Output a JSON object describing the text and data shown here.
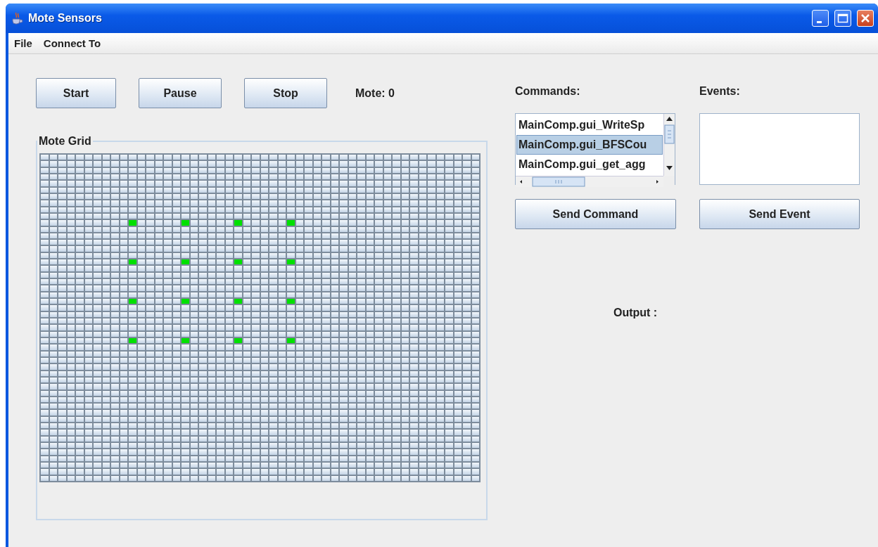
{
  "window": {
    "title": "Mote Sensors"
  },
  "menu": [
    "File",
    "Connect To"
  ],
  "controls": {
    "buttons": [
      "Start",
      "Pause",
      "Stop"
    ],
    "mote_label": "Mote: 0"
  },
  "grid": {
    "title": "Mote Grid",
    "rows": [
      [
        false,
        false,
        false,
        false,
        false,
        false,
        false,
        false,
        false,
        false,
        false,
        false,
        false,
        false,
        false,
        false,
        false,
        false,
        false,
        false,
        false,
        false,
        false,
        false,
        false,
        false,
        false,
        false,
        false,
        false,
        false,
        false,
        false,
        false,
        false,
        false,
        false,
        false,
        false,
        false,
        false,
        false,
        false,
        false,
        false,
        false,
        false,
        false,
        false,
        false
      ],
      [
        false,
        false,
        false,
        false,
        false,
        false,
        false,
        false,
        false,
        false,
        false,
        false,
        false,
        false,
        false,
        false,
        false,
        false,
        false,
        false,
        false,
        false,
        false,
        false,
        false,
        false,
        false,
        false,
        false,
        false,
        false,
        false,
        false,
        false,
        false,
        false,
        false,
        false,
        false,
        false,
        false,
        false,
        false,
        false,
        false,
        false,
        false,
        false,
        false,
        false
      ],
      [
        false,
        false,
        false,
        false,
        false,
        false,
        false,
        false,
        false,
        false,
        false,
        false,
        false,
        false,
        false,
        false,
        false,
        false,
        false,
        false,
        false,
        false,
        false,
        false,
        false,
        false,
        false,
        false,
        false,
        false,
        false,
        false,
        false,
        false,
        false,
        false,
        false,
        false,
        false,
        false,
        false,
        false,
        false,
        false,
        false,
        false,
        false,
        false,
        false,
        false
      ],
      [
        false,
        false,
        false,
        false,
        false,
        false,
        false,
        false,
        false,
        false,
        false,
        false,
        false,
        false,
        false,
        false,
        false,
        false,
        false,
        false,
        false,
        false,
        false,
        false,
        false,
        false,
        false,
        false,
        false,
        false,
        false,
        false,
        false,
        false,
        false,
        false,
        false,
        false,
        false,
        false,
        false,
        false,
        false,
        false,
        false,
        false,
        false,
        false,
        false,
        false
      ],
      [
        false,
        false,
        false,
        false,
        false,
        false,
        false,
        false,
        false,
        false,
        false,
        false,
        false,
        false,
        false,
        false,
        false,
        false,
        false,
        false,
        false,
        false,
        false,
        false,
        false,
        false,
        false,
        false,
        false,
        false,
        false,
        false,
        false,
        false,
        false,
        false,
        false,
        false,
        false,
        false,
        false,
        false,
        false,
        false,
        false,
        false,
        false,
        false,
        false,
        false
      ],
      [
        false,
        false,
        false,
        false,
        false,
        false,
        false,
        false,
        false,
        false,
        false,
        false,
        false,
        false,
        false,
        false,
        false,
        false,
        false,
        false,
        false,
        false,
        false,
        false,
        false,
        false,
        false,
        false,
        false,
        false,
        false,
        false,
        false,
        false,
        false,
        false,
        false,
        false,
        false,
        false,
        false,
        false,
        false,
        false,
        false,
        false,
        false,
        false,
        false,
        false
      ],
      [
        false,
        false,
        false,
        false,
        false,
        false,
        false,
        false,
        false,
        false,
        false,
        false,
        false,
        false,
        false,
        false,
        false,
        false,
        false,
        false,
        false,
        false,
        false,
        false,
        false,
        false,
        false,
        false,
        false,
        false,
        false,
        false,
        false,
        false,
        false,
        false,
        false,
        false,
        false,
        false,
        false,
        false,
        false,
        false,
        false,
        false,
        false,
        false,
        false,
        false
      ],
      [
        false,
        false,
        false,
        false,
        false,
        false,
        false,
        false,
        false,
        false,
        false,
        false,
        false,
        false,
        false,
        false,
        false,
        false,
        false,
        false,
        false,
        false,
        false,
        false,
        false,
        false,
        false,
        false,
        false,
        false,
        false,
        false,
        false,
        false,
        false,
        false,
        false,
        false,
        false,
        false,
        false,
        false,
        false,
        false,
        false,
        false,
        false,
        false,
        false,
        false
      ],
      [
        false,
        false,
        false,
        false,
        false,
        false,
        false,
        false,
        false,
        false,
        false,
        false,
        false,
        false,
        false,
        false,
        false,
        false,
        false,
        false,
        false,
        false,
        false,
        false,
        false,
        false,
        false,
        false,
        false,
        false,
        false,
        false,
        false,
        false,
        false,
        false,
        false,
        false,
        false,
        false,
        false,
        false,
        false,
        false,
        false,
        false,
        false,
        false,
        false,
        false
      ],
      [
        false,
        false,
        false,
        false,
        false,
        false,
        false,
        false,
        false,
        false,
        false,
        false,
        false,
        false,
        false,
        false,
        false,
        false,
        false,
        false,
        false,
        false,
        false,
        false,
        false,
        false,
        false,
        false,
        false,
        false,
        false,
        false,
        false,
        false,
        false,
        false,
        false,
        false,
        false,
        false,
        false,
        false,
        false,
        false,
        false,
        false,
        false,
        false,
        false,
        false
      ],
      [
        false,
        false,
        false,
        false,
        false,
        false,
        false,
        false,
        false,
        false,
        true,
        false,
        false,
        false,
        false,
        false,
        true,
        false,
        false,
        false,
        false,
        false,
        true,
        false,
        false,
        false,
        false,
        false,
        true,
        false,
        false,
        false,
        false,
        false,
        false,
        false,
        false,
        false,
        false,
        false,
        false,
        false,
        false,
        false,
        false,
        false,
        false,
        false,
        false,
        false
      ],
      [
        false,
        false,
        false,
        false,
        false,
        false,
        false,
        false,
        false,
        false,
        false,
        false,
        false,
        false,
        false,
        false,
        false,
        false,
        false,
        false,
        false,
        false,
        false,
        false,
        false,
        false,
        false,
        false,
        false,
        false,
        false,
        false,
        false,
        false,
        false,
        false,
        false,
        false,
        false,
        false,
        false,
        false,
        false,
        false,
        false,
        false,
        false,
        false,
        false,
        false
      ],
      [
        false,
        false,
        false,
        false,
        false,
        false,
        false,
        false,
        false,
        false,
        false,
        false,
        false,
        false,
        false,
        false,
        false,
        false,
        false,
        false,
        false,
        false,
        false,
        false,
        false,
        false,
        false,
        false,
        false,
        false,
        false,
        false,
        false,
        false,
        false,
        false,
        false,
        false,
        false,
        false,
        false,
        false,
        false,
        false,
        false,
        false,
        false,
        false,
        false,
        false
      ],
      [
        false,
        false,
        false,
        false,
        false,
        false,
        false,
        false,
        false,
        false,
        false,
        false,
        false,
        false,
        false,
        false,
        false,
        false,
        false,
        false,
        false,
        false,
        false,
        false,
        false,
        false,
        false,
        false,
        false,
        false,
        false,
        false,
        false,
        false,
        false,
        false,
        false,
        false,
        false,
        false,
        false,
        false,
        false,
        false,
        false,
        false,
        false,
        false,
        false,
        false
      ],
      [
        false,
        false,
        false,
        false,
        false,
        false,
        false,
        false,
        false,
        false,
        false,
        false,
        false,
        false,
        false,
        false,
        false,
        false,
        false,
        false,
        false,
        false,
        false,
        false,
        false,
        false,
        false,
        false,
        false,
        false,
        false,
        false,
        false,
        false,
        false,
        false,
        false,
        false,
        false,
        false,
        false,
        false,
        false,
        false,
        false,
        false,
        false,
        false,
        false,
        false
      ],
      [
        false,
        false,
        false,
        false,
        false,
        false,
        false,
        false,
        false,
        false,
        false,
        false,
        false,
        false,
        false,
        false,
        false,
        false,
        false,
        false,
        false,
        false,
        false,
        false,
        false,
        false,
        false,
        false,
        false,
        false,
        false,
        false,
        false,
        false,
        false,
        false,
        false,
        false,
        false,
        false,
        false,
        false,
        false,
        false,
        false,
        false,
        false,
        false,
        false,
        false
      ],
      [
        false,
        false,
        false,
        false,
        false,
        false,
        false,
        false,
        false,
        false,
        true,
        false,
        false,
        false,
        false,
        false,
        true,
        false,
        false,
        false,
        false,
        false,
        true,
        false,
        false,
        false,
        false,
        false,
        true,
        false,
        false,
        false,
        false,
        false,
        false,
        false,
        false,
        false,
        false,
        false,
        false,
        false,
        false,
        false,
        false,
        false,
        false,
        false,
        false,
        false
      ],
      [
        false,
        false,
        false,
        false,
        false,
        false,
        false,
        false,
        false,
        false,
        false,
        false,
        false,
        false,
        false,
        false,
        false,
        false,
        false,
        false,
        false,
        false,
        false,
        false,
        false,
        false,
        false,
        false,
        false,
        false,
        false,
        false,
        false,
        false,
        false,
        false,
        false,
        false,
        false,
        false,
        false,
        false,
        false,
        false,
        false,
        false,
        false,
        false,
        false,
        false
      ],
      [
        false,
        false,
        false,
        false,
        false,
        false,
        false,
        false,
        false,
        false,
        false,
        false,
        false,
        false,
        false,
        false,
        false,
        false,
        false,
        false,
        false,
        false,
        false,
        false,
        false,
        false,
        false,
        false,
        false,
        false,
        false,
        false,
        false,
        false,
        false,
        false,
        false,
        false,
        false,
        false,
        false,
        false,
        false,
        false,
        false,
        false,
        false,
        false,
        false,
        false
      ],
      [
        false,
        false,
        false,
        false,
        false,
        false,
        false,
        false,
        false,
        false,
        false,
        false,
        false,
        false,
        false,
        false,
        false,
        false,
        false,
        false,
        false,
        false,
        false,
        false,
        false,
        false,
        false,
        false,
        false,
        false,
        false,
        false,
        false,
        false,
        false,
        false,
        false,
        false,
        false,
        false,
        false,
        false,
        false,
        false,
        false,
        false,
        false,
        false,
        false,
        false
      ],
      [
        false,
        false,
        false,
        false,
        false,
        false,
        false,
        false,
        false,
        false,
        false,
        false,
        false,
        false,
        false,
        false,
        false,
        false,
        false,
        false,
        false,
        false,
        false,
        false,
        false,
        false,
        false,
        false,
        false,
        false,
        false,
        false,
        false,
        false,
        false,
        false,
        false,
        false,
        false,
        false,
        false,
        false,
        false,
        false,
        false,
        false,
        false,
        false,
        false,
        false
      ],
      [
        false,
        false,
        false,
        false,
        false,
        false,
        false,
        false,
        false,
        false,
        false,
        false,
        false,
        false,
        false,
        false,
        false,
        false,
        false,
        false,
        false,
        false,
        false,
        false,
        false,
        false,
        false,
        false,
        false,
        false,
        false,
        false,
        false,
        false,
        false,
        false,
        false,
        false,
        false,
        false,
        false,
        false,
        false,
        false,
        false,
        false,
        false,
        false,
        false,
        false
      ],
      [
        false,
        false,
        false,
        false,
        false,
        false,
        false,
        false,
        false,
        false,
        true,
        false,
        false,
        false,
        false,
        false,
        true,
        false,
        false,
        false,
        false,
        false,
        true,
        false,
        false,
        false,
        false,
        false,
        true,
        false,
        false,
        false,
        false,
        false,
        false,
        false,
        false,
        false,
        false,
        false,
        false,
        false,
        false,
        false,
        false,
        false,
        false,
        false,
        false,
        false
      ],
      [
        false,
        false,
        false,
        false,
        false,
        false,
        false,
        false,
        false,
        false,
        false,
        false,
        false,
        false,
        false,
        false,
        false,
        false,
        false,
        false,
        false,
        false,
        false,
        false,
        false,
        false,
        false,
        false,
        false,
        false,
        false,
        false,
        false,
        false,
        false,
        false,
        false,
        false,
        false,
        false,
        false,
        false,
        false,
        false,
        false,
        false,
        false,
        false,
        false,
        false
      ],
      [
        false,
        false,
        false,
        false,
        false,
        false,
        false,
        false,
        false,
        false,
        false,
        false,
        false,
        false,
        false,
        false,
        false,
        false,
        false,
        false,
        false,
        false,
        false,
        false,
        false,
        false,
        false,
        false,
        false,
        false,
        false,
        false,
        false,
        false,
        false,
        false,
        false,
        false,
        false,
        false,
        false,
        false,
        false,
        false,
        false,
        false,
        false,
        false,
        false,
        false
      ],
      [
        false,
        false,
        false,
        false,
        false,
        false,
        false,
        false,
        false,
        false,
        false,
        false,
        false,
        false,
        false,
        false,
        false,
        false,
        false,
        false,
        false,
        false,
        false,
        false,
        false,
        false,
        false,
        false,
        false,
        false,
        false,
        false,
        false,
        false,
        false,
        false,
        false,
        false,
        false,
        false,
        false,
        false,
        false,
        false,
        false,
        false,
        false,
        false,
        false,
        false
      ],
      [
        false,
        false,
        false,
        false,
        false,
        false,
        false,
        false,
        false,
        false,
        false,
        false,
        false,
        false,
        false,
        false,
        false,
        false,
        false,
        false,
        false,
        false,
        false,
        false,
        false,
        false,
        false,
        false,
        false,
        false,
        false,
        false,
        false,
        false,
        false,
        false,
        false,
        false,
        false,
        false,
        false,
        false,
        false,
        false,
        false,
        false,
        false,
        false,
        false,
        false
      ],
      [
        false,
        false,
        false,
        false,
        false,
        false,
        false,
        false,
        false,
        false,
        false,
        false,
        false,
        false,
        false,
        false,
        false,
        false,
        false,
        false,
        false,
        false,
        false,
        false,
        false,
        false,
        false,
        false,
        false,
        false,
        false,
        false,
        false,
        false,
        false,
        false,
        false,
        false,
        false,
        false,
        false,
        false,
        false,
        false,
        false,
        false,
        false,
        false,
        false,
        false
      ],
      [
        false,
        false,
        false,
        false,
        false,
        false,
        false,
        false,
        false,
        false,
        true,
        false,
        false,
        false,
        false,
        false,
        true,
        false,
        false,
        false,
        false,
        false,
        true,
        false,
        false,
        false,
        false,
        false,
        true,
        false,
        false,
        false,
        false,
        false,
        false,
        false,
        false,
        false,
        false,
        false,
        false,
        false,
        false,
        false,
        false,
        false,
        false,
        false,
        false,
        false
      ],
      [
        false,
        false,
        false,
        false,
        false,
        false,
        false,
        false,
        false,
        false,
        false,
        false,
        false,
        false,
        false,
        false,
        false,
        false,
        false,
        false,
        false,
        false,
        false,
        false,
        false,
        false,
        false,
        false,
        false,
        false,
        false,
        false,
        false,
        false,
        false,
        false,
        false,
        false,
        false,
        false,
        false,
        false,
        false,
        false,
        false,
        false,
        false,
        false,
        false,
        false
      ],
      [
        false,
        false,
        false,
        false,
        false,
        false,
        false,
        false,
        false,
        false,
        false,
        false,
        false,
        false,
        false,
        false,
        false,
        false,
        false,
        false,
        false,
        false,
        false,
        false,
        false,
        false,
        false,
        false,
        false,
        false,
        false,
        false,
        false,
        false,
        false,
        false,
        false,
        false,
        false,
        false,
        false,
        false,
        false,
        false,
        false,
        false,
        false,
        false,
        false,
        false
      ],
      [
        false,
        false,
        false,
        false,
        false,
        false,
        false,
        false,
        false,
        false,
        false,
        false,
        false,
        false,
        false,
        false,
        false,
        false,
        false,
        false,
        false,
        false,
        false,
        false,
        false,
        false,
        false,
        false,
        false,
        false,
        false,
        false,
        false,
        false,
        false,
        false,
        false,
        false,
        false,
        false,
        false,
        false,
        false,
        false,
        false,
        false,
        false,
        false,
        false,
        false
      ],
      [
        false,
        false,
        false,
        false,
        false,
        false,
        false,
        false,
        false,
        false,
        false,
        false,
        false,
        false,
        false,
        false,
        false,
        false,
        false,
        false,
        false,
        false,
        false,
        false,
        false,
        false,
        false,
        false,
        false,
        false,
        false,
        false,
        false,
        false,
        false,
        false,
        false,
        false,
        false,
        false,
        false,
        false,
        false,
        false,
        false,
        false,
        false,
        false,
        false,
        false
      ],
      [
        false,
        false,
        false,
        false,
        false,
        false,
        false,
        false,
        false,
        false,
        false,
        false,
        false,
        false,
        false,
        false,
        false,
        false,
        false,
        false,
        false,
        false,
        false,
        false,
        false,
        false,
        false,
        false,
        false,
        false,
        false,
        false,
        false,
        false,
        false,
        false,
        false,
        false,
        false,
        false,
        false,
        false,
        false,
        false,
        false,
        false,
        false,
        false,
        false,
        false
      ],
      [
        false,
        false,
        false,
        false,
        false,
        false,
        false,
        false,
        false,
        false,
        false,
        false,
        false,
        false,
        false,
        false,
        false,
        false,
        false,
        false,
        false,
        false,
        false,
        false,
        false,
        false,
        false,
        false,
        false,
        false,
        false,
        false,
        false,
        false,
        false,
        false,
        false,
        false,
        false,
        false,
        false,
        false,
        false,
        false,
        false,
        false,
        false,
        false,
        false,
        false
      ],
      [
        false,
        false,
        false,
        false,
        false,
        false,
        false,
        false,
        false,
        false,
        false,
        false,
        false,
        false,
        false,
        false,
        false,
        false,
        false,
        false,
        false,
        false,
        false,
        false,
        false,
        false,
        false,
        false,
        false,
        false,
        false,
        false,
        false,
        false,
        false,
        false,
        false,
        false,
        false,
        false,
        false,
        false,
        false,
        false,
        false,
        false,
        false,
        false,
        false,
        false
      ],
      [
        false,
        false,
        false,
        false,
        false,
        false,
        false,
        false,
        false,
        false,
        false,
        false,
        false,
        false,
        false,
        false,
        false,
        false,
        false,
        false,
        false,
        false,
        false,
        false,
        false,
        false,
        false,
        false,
        false,
        false,
        false,
        false,
        false,
        false,
        false,
        false,
        false,
        false,
        false,
        false,
        false,
        false,
        false,
        false,
        false,
        false,
        false,
        false,
        false,
        false
      ],
      [
        false,
        false,
        false,
        false,
        false,
        false,
        false,
        false,
        false,
        false,
        false,
        false,
        false,
        false,
        false,
        false,
        false,
        false,
        false,
        false,
        false,
        false,
        false,
        false,
        false,
        false,
        false,
        false,
        false,
        false,
        false,
        false,
        false,
        false,
        false,
        false,
        false,
        false,
        false,
        false,
        false,
        false,
        false,
        false,
        false,
        false,
        false,
        false,
        false,
        false
      ],
      [
        false,
        false,
        false,
        false,
        false,
        false,
        false,
        false,
        false,
        false,
        false,
        false,
        false,
        false,
        false,
        false,
        false,
        false,
        false,
        false,
        false,
        false,
        false,
        false,
        false,
        false,
        false,
        false,
        false,
        false,
        false,
        false,
        false,
        false,
        false,
        false,
        false,
        false,
        false,
        false,
        false,
        false,
        false,
        false,
        false,
        false,
        false,
        false,
        false,
        false
      ],
      [
        false,
        false,
        false,
        false,
        false,
        false,
        false,
        false,
        false,
        false,
        false,
        false,
        false,
        false,
        false,
        false,
        false,
        false,
        false,
        false,
        false,
        false,
        false,
        false,
        false,
        false,
        false,
        false,
        false,
        false,
        false,
        false,
        false,
        false,
        false,
        false,
        false,
        false,
        false,
        false,
        false,
        false,
        false,
        false,
        false,
        false,
        false,
        false,
        false,
        false
      ],
      [
        false,
        false,
        false,
        false,
        false,
        false,
        false,
        false,
        false,
        false,
        false,
        false,
        false,
        false,
        false,
        false,
        false,
        false,
        false,
        false,
        false,
        false,
        false,
        false,
        false,
        false,
        false,
        false,
        false,
        false,
        false,
        false,
        false,
        false,
        false,
        false,
        false,
        false,
        false,
        false,
        false,
        false,
        false,
        false,
        false,
        false,
        false,
        false,
        false,
        false
      ],
      [
        false,
        false,
        false,
        false,
        false,
        false,
        false,
        false,
        false,
        false,
        false,
        false,
        false,
        false,
        false,
        false,
        false,
        false,
        false,
        false,
        false,
        false,
        false,
        false,
        false,
        false,
        false,
        false,
        false,
        false,
        false,
        false,
        false,
        false,
        false,
        false,
        false,
        false,
        false,
        false,
        false,
        false,
        false,
        false,
        false,
        false,
        false,
        false,
        false,
        false
      ],
      [
        false,
        false,
        false,
        false,
        false,
        false,
        false,
        false,
        false,
        false,
        false,
        false,
        false,
        false,
        false,
        false,
        false,
        false,
        false,
        false,
        false,
        false,
        false,
        false,
        false,
        false,
        false,
        false,
        false,
        false,
        false,
        false,
        false,
        false,
        false,
        false,
        false,
        false,
        false,
        false,
        false,
        false,
        false,
        false,
        false,
        false,
        false,
        false,
        false,
        false
      ],
      [
        false,
        false,
        false,
        false,
        false,
        false,
        false,
        false,
        false,
        false,
        false,
        false,
        false,
        false,
        false,
        false,
        false,
        false,
        false,
        false,
        false,
        false,
        false,
        false,
        false,
        false,
        false,
        false,
        false,
        false,
        false,
        false,
        false,
        false,
        false,
        false,
        false,
        false,
        false,
        false,
        false,
        false,
        false,
        false,
        false,
        false,
        false,
        false,
        false,
        false
      ],
      [
        false,
        false,
        false,
        false,
        false,
        false,
        false,
        false,
        false,
        false,
        false,
        false,
        false,
        false,
        false,
        false,
        false,
        false,
        false,
        false,
        false,
        false,
        false,
        false,
        false,
        false,
        false,
        false,
        false,
        false,
        false,
        false,
        false,
        false,
        false,
        false,
        false,
        false,
        false,
        false,
        false,
        false,
        false,
        false,
        false,
        false,
        false,
        false,
        false,
        false
      ],
      [
        false,
        false,
        false,
        false,
        false,
        false,
        false,
        false,
        false,
        false,
        false,
        false,
        false,
        false,
        false,
        false,
        false,
        false,
        false,
        false,
        false,
        false,
        false,
        false,
        false,
        false,
        false,
        false,
        false,
        false,
        false,
        false,
        false,
        false,
        false,
        false,
        false,
        false,
        false,
        false,
        false,
        false,
        false,
        false,
        false,
        false,
        false,
        false,
        false,
        false
      ],
      [
        false,
        false,
        false,
        false,
        false,
        false,
        false,
        false,
        false,
        false,
        false,
        false,
        false,
        false,
        false,
        false,
        false,
        false,
        false,
        false,
        false,
        false,
        false,
        false,
        false,
        false,
        false,
        false,
        false,
        false,
        false,
        false,
        false,
        false,
        false,
        false,
        false,
        false,
        false,
        false,
        false,
        false,
        false,
        false,
        false,
        false,
        false,
        false,
        false,
        false
      ],
      [
        false,
        false,
        false,
        false,
        false,
        false,
        false,
        false,
        false,
        false,
        false,
        false,
        false,
        false,
        false,
        false,
        false,
        false,
        false,
        false,
        false,
        false,
        false,
        false,
        false,
        false,
        false,
        false,
        false,
        false,
        false,
        false,
        false,
        false,
        false,
        false,
        false,
        false,
        false,
        false,
        false,
        false,
        false,
        false,
        false,
        false,
        false,
        false,
        false,
        false
      ],
      [
        false,
        false,
        false,
        false,
        false,
        false,
        false,
        false,
        false,
        false,
        false,
        false,
        false,
        false,
        false,
        false,
        false,
        false,
        false,
        false,
        false,
        false,
        false,
        false,
        false,
        false,
        false,
        false,
        false,
        false,
        false,
        false,
        false,
        false,
        false,
        false,
        false,
        false,
        false,
        false,
        false,
        false,
        false,
        false,
        false,
        false,
        false,
        false,
        false,
        false
      ],
      [
        false,
        false,
        false,
        false,
        false,
        false,
        false,
        false,
        false,
        false,
        false,
        false,
        false,
        false,
        false,
        false,
        false,
        false,
        false,
        false,
        false,
        false,
        false,
        false,
        false,
        false,
        false,
        false,
        false,
        false,
        false,
        false,
        false,
        false,
        false,
        false,
        false,
        false,
        false,
        false,
        false,
        false,
        false,
        false,
        false,
        false,
        false,
        false,
        false,
        false
      ]
    ]
  },
  "commands": {
    "label": "Commands:",
    "items": [
      {
        "text": "MainComp.gui_WriteSp",
        "selected": false
      },
      {
        "text": "MainComp.gui_BFSCou",
        "selected": true
      },
      {
        "text": "MainComp.gui_get_agg",
        "selected": false
      }
    ],
    "button": "Send Command"
  },
  "events": {
    "label": "Events:",
    "button": "Send Event"
  },
  "output": {
    "label": "Output :"
  }
}
